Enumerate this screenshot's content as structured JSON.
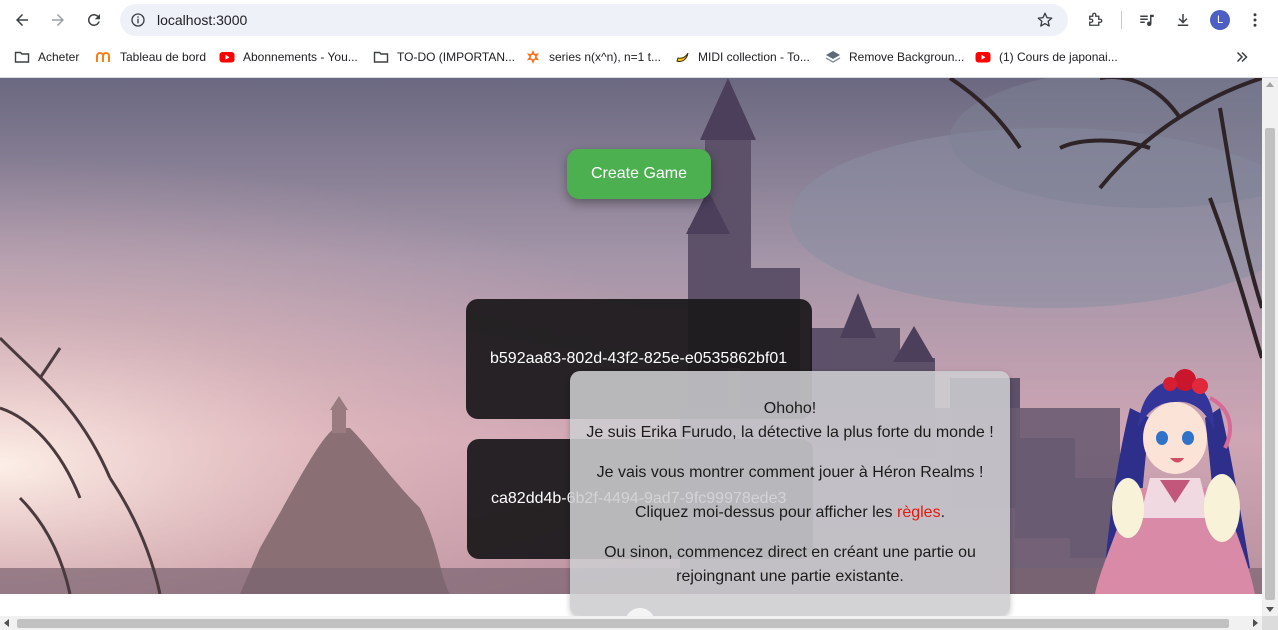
{
  "browser": {
    "url": "localhost:3000",
    "avatar_letter": "L",
    "bookmarks": [
      {
        "label": "Acheter",
        "icon": "folder-icon"
      },
      {
        "label": "Tableau de bord",
        "icon": "moodle-icon"
      },
      {
        "label": "Abonnements - You...",
        "icon": "youtube-icon"
      },
      {
        "label": "TO-DO (IMPORTAN...",
        "icon": "folder-icon"
      },
      {
        "label": "series n(x^n), n=1 t...",
        "icon": "wolfram-icon"
      },
      {
        "label": "MIDI collection - To...",
        "icon": "banana-icon"
      },
      {
        "label": "Remove Backgroun...",
        "icon": "layers-icon"
      },
      {
        "label": "(1) Cours de japonai...",
        "icon": "youtube-icon"
      }
    ]
  },
  "page": {
    "create_button": "Create Game",
    "games": [
      "b592aa83-802d-43f2-825e-e0535862bf01",
      "ca82dd4b-6b2f-4494-9ad7-9fc99978ede3"
    ],
    "dialog": {
      "line1": "Ohoho!",
      "line2": "Je suis Erika Furudo, la détective la plus forte du monde !",
      "line3": "Je vais vous montrer comment jouer à Héron Realms !",
      "line4_before": "Cliquez moi-dessus pour afficher les ",
      "line4_link": "règles",
      "line4_after": ".",
      "line5a": "Ou sinon, commencez direct en créant une partie ou",
      "line5b": "rejoingnant une partie existante."
    }
  },
  "colors": {
    "create_button": "#4caf50",
    "game_card": "#1c1a1c",
    "rules_link": "#e8170d",
    "dialog_bg": "#cdcdd0"
  }
}
